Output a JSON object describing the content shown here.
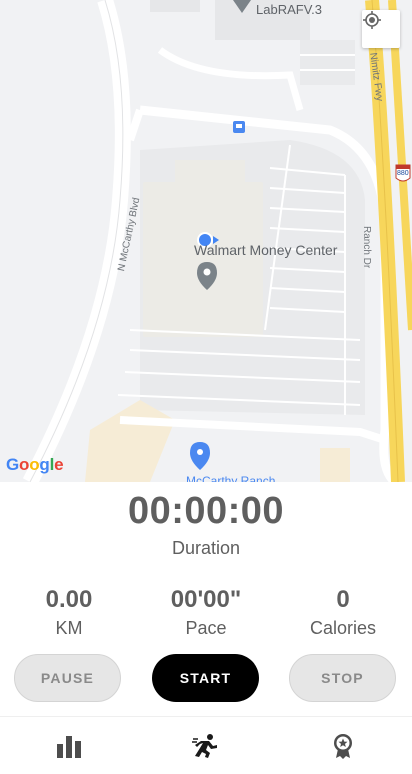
{
  "map": {
    "place_top": "LabRAFV.3",
    "place_main": "Walmart Money Center",
    "place_bottom": "McCarthy Ranch",
    "road_west": "N McCarthy Blvd",
    "road_east": "Ranch Dr",
    "highway": "Nimitz Fwy",
    "highway_shield": "880",
    "attribution": [
      "G",
      "o",
      "o",
      "g",
      "l",
      "e"
    ],
    "attribution_colors": [
      "#4285F4",
      "#EA4335",
      "#FBBC05",
      "#4285F4",
      "#34A853",
      "#EA4335"
    ],
    "locate_icon": "my-location-icon"
  },
  "workout": {
    "duration_value": "00:00:00",
    "duration_label": "Duration",
    "distance_value": "0.00",
    "distance_label": "KM",
    "pace_value": "00'00\"",
    "pace_label": "Pace",
    "calories_value": "0",
    "calories_label": "Calories"
  },
  "controls": {
    "pause_label": "PAUSE",
    "start_label": "START",
    "stop_label": "STOP"
  },
  "bottom_nav": {
    "items": [
      {
        "icon": "bar-chart-icon"
      },
      {
        "icon": "running-icon"
      },
      {
        "icon": "award-badge-icon"
      }
    ]
  },
  "colors": {
    "accent": "#000000",
    "text": "#5f5f5f",
    "highway": "#f7d65b",
    "place_pin": "#7b8389",
    "poi_pin": "#4a88f0",
    "location_dot": "#4285f4"
  }
}
